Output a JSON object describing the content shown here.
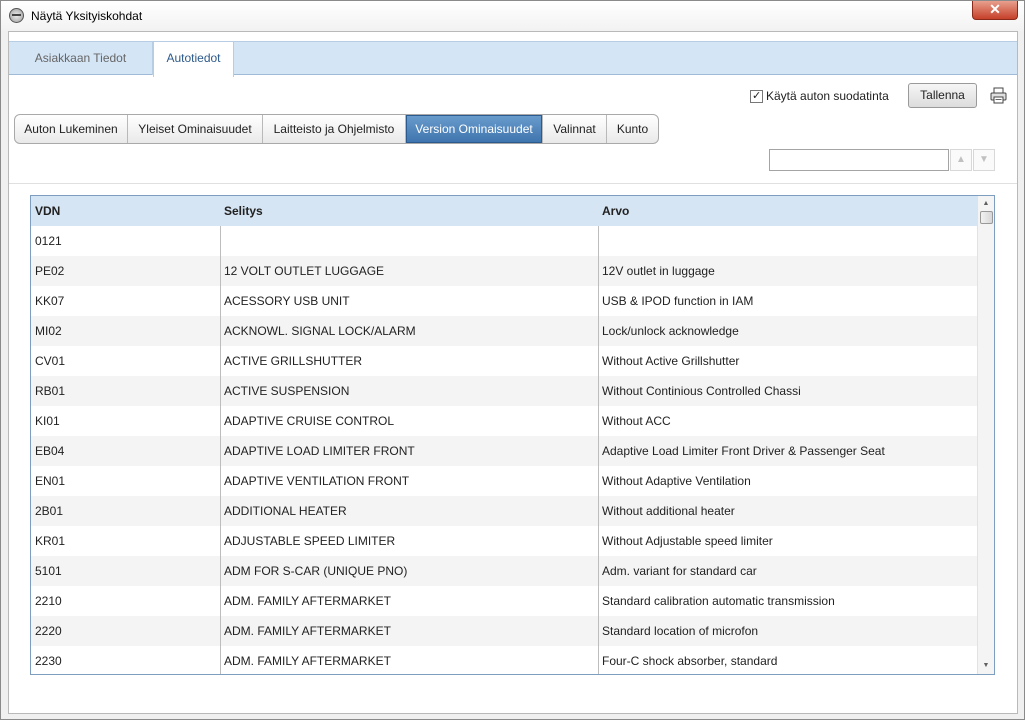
{
  "window": {
    "title": "Näytä Yksityiskohdat",
    "close_label": "✕"
  },
  "top_tabs": [
    {
      "label": "Asiakkaan Tiedot",
      "active": false
    },
    {
      "label": "Autotiedot",
      "active": true
    }
  ],
  "toolbar": {
    "filter_checked": true,
    "filter_label": "Käytä auton suodatinta",
    "save_label": "Tallenna",
    "print_icon": "printer-icon"
  },
  "sub_tabs": [
    {
      "label": "Auton Lukeminen",
      "active": false
    },
    {
      "label": "Yleiset Ominaisuudet",
      "active": false
    },
    {
      "label": "Laitteisto ja Ohjelmisto",
      "active": false
    },
    {
      "label": "Version Ominaisuudet",
      "active": true
    },
    {
      "label": "Valinnat",
      "active": false
    },
    {
      "label": "Kunto",
      "active": false
    }
  ],
  "search": {
    "value": "",
    "placeholder": "",
    "up_icon": "chevron-up-icon",
    "down_icon": "chevron-down-icon"
  },
  "table": {
    "columns": [
      "VDN",
      "Selitys",
      "Arvo"
    ],
    "rows": [
      [
        "0121",
        "",
        ""
      ],
      [
        "PE02",
        "12 VOLT OUTLET LUGGAGE",
        "12V outlet in luggage"
      ],
      [
        "KK07",
        "ACESSORY USB UNIT",
        "USB & IPOD function in IAM"
      ],
      [
        "MI02",
        "ACKNOWL. SIGNAL LOCK/ALARM",
        "Lock/unlock acknowledge"
      ],
      [
        "CV01",
        "ACTIVE GRILLSHUTTER",
        "Without Active Grillshutter"
      ],
      [
        "RB01",
        "ACTIVE SUSPENSION",
        "Without Continious Controlled Chassi"
      ],
      [
        "KI01",
        "ADAPTIVE CRUISE CONTROL",
        "Without ACC"
      ],
      [
        "EB04",
        "ADAPTIVE LOAD LIMITER FRONT",
        "Adaptive Load Limiter Front Driver & Passenger Seat"
      ],
      [
        "EN01",
        "ADAPTIVE VENTILATION FRONT",
        "Without Adaptive Ventilation"
      ],
      [
        "2B01",
        "ADDITIONAL HEATER",
        "Without additional heater"
      ],
      [
        "KR01",
        "ADJUSTABLE SPEED LIMITER",
        "Without Adjustable speed limiter"
      ],
      [
        "5101",
        "ADM FOR S-CAR (UNIQUE PNO)",
        "Adm. variant for standard car"
      ],
      [
        "2210",
        "ADM. FAMILY AFTERMARKET",
        "Standard calibration automatic transmission"
      ],
      [
        "2220",
        "ADM. FAMILY AFTERMARKET",
        "Standard location of microfon"
      ],
      [
        "2230",
        "ADM. FAMILY AFTERMARKET",
        "Four-C shock absorber, standard"
      ]
    ]
  },
  "scrollbar": {
    "up_arrow": "▲",
    "down_arrow": "▼"
  }
}
